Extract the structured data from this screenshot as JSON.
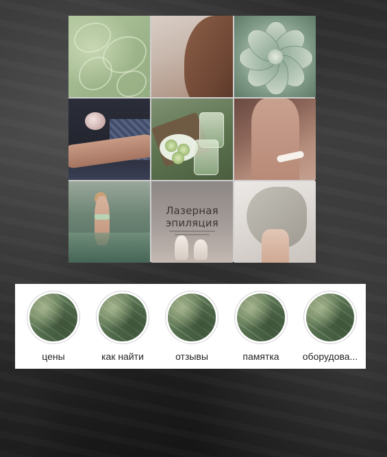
{
  "grid": {
    "post_text": "Лазерная эпиляция"
  },
  "highlights": {
    "items": [
      {
        "label": "цены"
      },
      {
        "label": "как найти"
      },
      {
        "label": "отзывы"
      },
      {
        "label": "памятка"
      },
      {
        "label": "оборудова..."
      }
    ]
  }
}
